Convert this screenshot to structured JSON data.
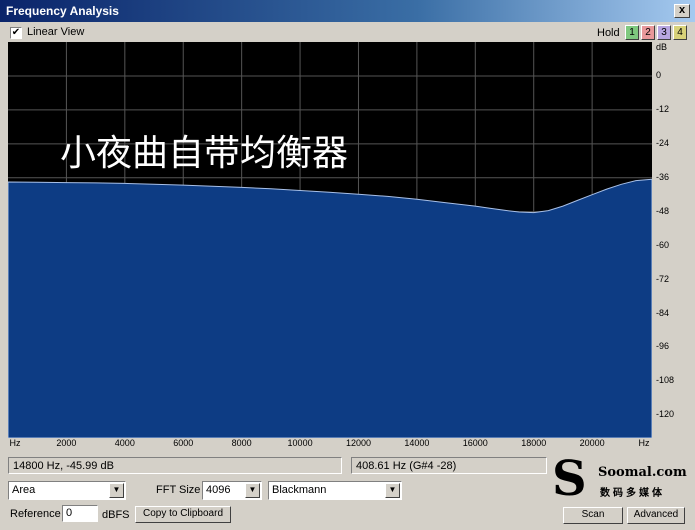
{
  "window": {
    "title": "Frequency Analysis",
    "close_glyph": "x"
  },
  "options": {
    "linear_view_label": "Linear View",
    "linear_view_checked": true,
    "check_glyph": "✔"
  },
  "hold": {
    "label": "Hold",
    "buttons": [
      {
        "label": "1",
        "color": "#7fc97f"
      },
      {
        "label": "2",
        "color": "#e8989a"
      },
      {
        "label": "3",
        "color": "#b7a6e0"
      },
      {
        "label": "4",
        "color": "#d8d27a"
      }
    ]
  },
  "overlay_text": "小夜曲自带均衡器",
  "chart_data": {
    "type": "area",
    "xlabel": "Hz",
    "ylabel": "dB",
    "xlim": [
      0,
      22050
    ],
    "ylim": [
      -128,
      12
    ],
    "x_ticks": [
      2000,
      4000,
      6000,
      8000,
      10000,
      12000,
      14000,
      16000,
      18000,
      20000
    ],
    "y_ticks": [
      0,
      -12,
      -24,
      -36,
      -48,
      -60,
      -72,
      -84,
      -96,
      -108,
      -120
    ],
    "grid": true,
    "fill_color": "#0d3c84",
    "series": [
      {
        "x": [
          0,
          1000,
          2000,
          3000,
          4000,
          5000,
          6000,
          7000,
          8000,
          9000,
          10000,
          11000,
          12000,
          13000,
          14000,
          15000,
          16000,
          16500,
          17000,
          17500,
          18000,
          18500,
          19000,
          19500,
          20000,
          20500,
          21000,
          21500,
          22050
        ],
        "y": [
          -37.5,
          -37.6,
          -37.7,
          -37.8,
          -38.0,
          -38.3,
          -38.6,
          -39.0,
          -39.4,
          -39.9,
          -40.5,
          -41.1,
          -41.8,
          -42.6,
          -43.6,
          -44.8,
          -46.0,
          -46.8,
          -47.5,
          -48.1,
          -48.3,
          -47.6,
          -46.0,
          -44.0,
          -42.0,
          -40.0,
          -38.3,
          -37.0,
          -36.5
        ]
      }
    ]
  },
  "status": {
    "cursor_readout": "14800 Hz, -45.99 dB",
    "peak_readout": "408.61 Hz (G#4 -28)"
  },
  "controls": {
    "display_mode": "Area",
    "fft_size_label": "FFT Size",
    "fft_size": "4096",
    "window_fn": "Blackmann",
    "reference_label": "Reference",
    "reference_value": "0",
    "reference_unit": "dBFS",
    "copy_label": "Copy to Clipboard",
    "scan_label": "Scan",
    "advanced_label": "Advanced",
    "arrow_glyph": "▼"
  },
  "logo": {
    "mark": "S",
    "name": "Soomal.com",
    "subtitle": "数码多媒体"
  }
}
